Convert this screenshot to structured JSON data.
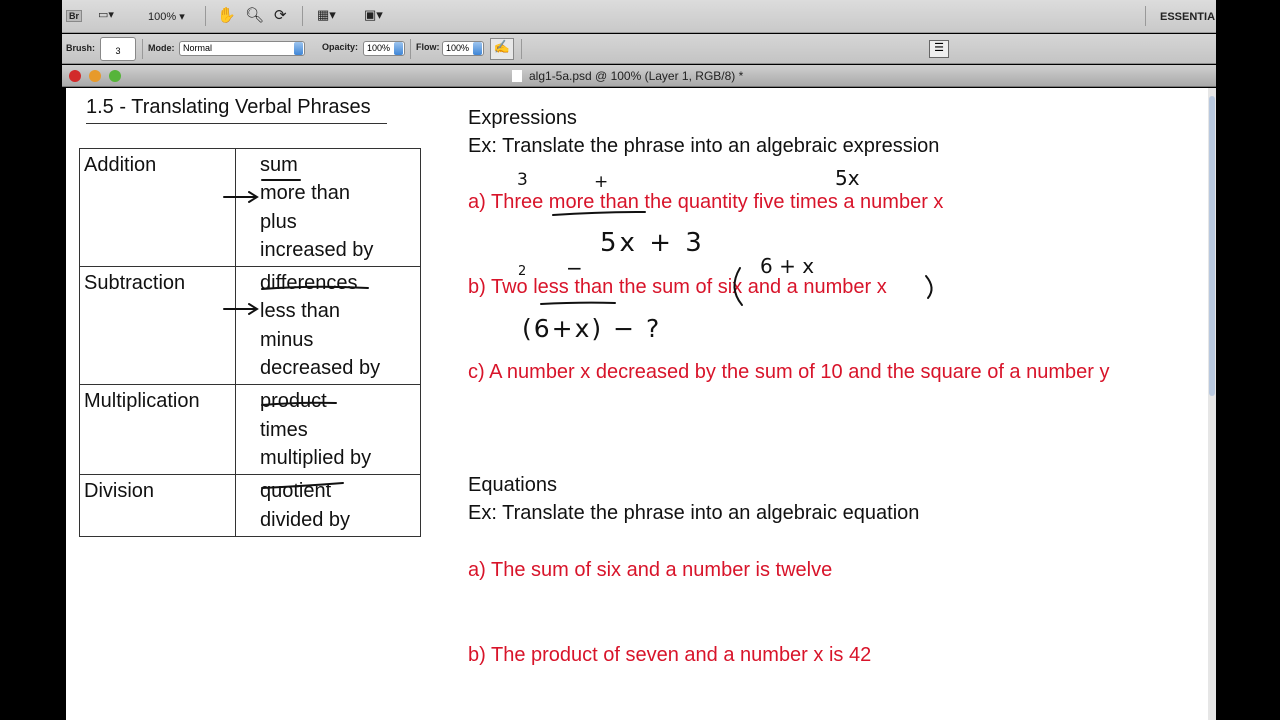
{
  "app_bar": {
    "bridge": "Br",
    "zoom": "100%",
    "workspace": "ESSENTIA"
  },
  "options_bar": {
    "brush_label": "Brush:",
    "brush_size": "3",
    "mode_label": "Mode:",
    "mode_value": "Normal",
    "opacity_label": "Opacity:",
    "opacity_value": "100%",
    "flow_label": "Flow:",
    "flow_value": "100%"
  },
  "window": {
    "title": "alg1-5a.psd @ 100% (Layer 1, RGB/8) *"
  },
  "document": {
    "heading": "1.5 - Translating Verbal Phrases",
    "table": [
      {
        "operation": "Addition",
        "words": [
          "sum",
          "more than",
          "plus",
          "increased by"
        ]
      },
      {
        "operation": "Subtraction",
        "words": [
          "differences",
          "less than",
          "minus",
          "decreased by"
        ]
      },
      {
        "operation": "Multiplication",
        "words": [
          "product",
          "times",
          "multiplied by"
        ]
      },
      {
        "operation": "Division",
        "words": [
          "quotient",
          "divided by"
        ]
      }
    ],
    "expressions": {
      "title": "Expressions",
      "instruction": "Ex:  Translate the phrase into an algebraic expression",
      "a": "a) Three more than the quantity five times a number x",
      "b": "b) Two less than the sum of six and a number x",
      "c": "c) A number x decreased by the sum of 10 and the square of a number y"
    },
    "equations": {
      "title": "Equations",
      "instruction": "Ex:  Translate the phrase into an algebraic equation",
      "a": "a) The sum of six and a number is twelve",
      "b": "b) The product of seven and a number x is 42"
    },
    "handwriting": {
      "a_three": "3",
      "a_plus": "+",
      "a_5x": "5x",
      "a_answer": "5x + 3",
      "b_two": "2",
      "b_minus": "−",
      "b_6x": "6 + x",
      "b_answer": "(6+x) − ?"
    }
  }
}
